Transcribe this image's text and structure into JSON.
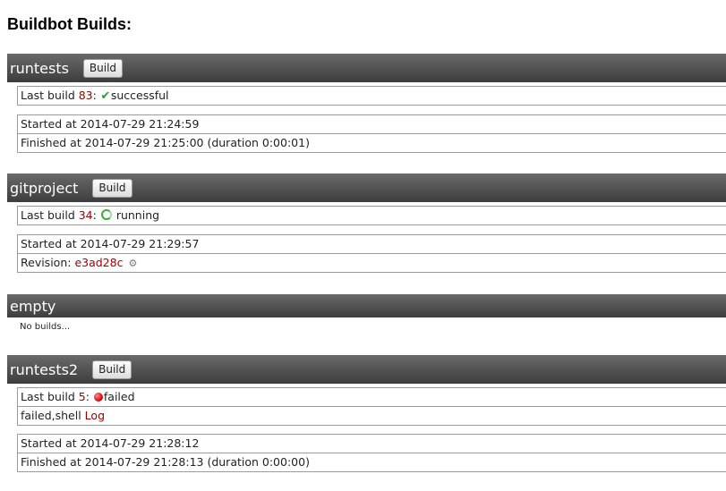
{
  "page": {
    "title": "Buildbot Builds:"
  },
  "builders": [
    {
      "name": "runtests",
      "build_label": "Build",
      "last_build_prefix": "Last build",
      "last_build_number": "83",
      "last_build_sep": ":",
      "status_icon": "checkmark-icon",
      "status_text": "successful",
      "started": "Started at 2014-07-29 21:24:59",
      "finished": "Finished at 2014-07-29 21:25:00 (duration 0:00:01)"
    },
    {
      "name": "gitproject",
      "build_label": "Build",
      "last_build_prefix": "Last build",
      "last_build_number": "34",
      "last_build_sep": ":",
      "status_icon": "spinner-icon",
      "status_text": "running",
      "started": "Started at 2014-07-29 21:29:57",
      "revision_label": "Revision:",
      "revision_value": "e3ad28c",
      "revision_icon": "gear-icon"
    },
    {
      "name": "empty",
      "no_builds_text": "No builds..."
    },
    {
      "name": "runtests2",
      "build_label": "Build",
      "last_build_prefix": "Last build",
      "last_build_number": "5",
      "last_build_sep": ":",
      "status_icon": "red-dot-icon",
      "status_text": "failed",
      "failure_text": "failed,shell",
      "log_link": "Log",
      "started": "Started at 2014-07-29 21:28:12",
      "finished": "Finished at 2014-07-29 21:28:13 (duration 0:00:00)"
    }
  ],
  "colors": {
    "header_bg": "#4a4a4a",
    "link": "#990000",
    "success": "#2da02d",
    "running": "#3caa3c",
    "failed": "#d41010"
  }
}
